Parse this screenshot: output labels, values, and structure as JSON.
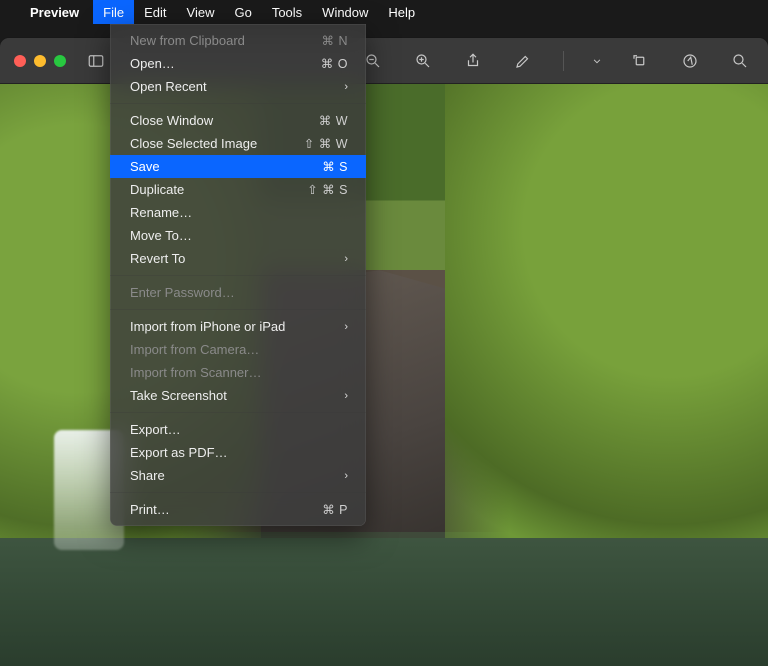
{
  "menubar": {
    "app_name": "Preview",
    "items": [
      "File",
      "Edit",
      "View",
      "Go",
      "Tools",
      "Window",
      "Help"
    ],
    "active_index": 0
  },
  "toolbar": {
    "icons": [
      "sidebar",
      "zoom-out",
      "zoom-in",
      "share",
      "markup",
      "dropdown",
      "rotate",
      "info",
      "search"
    ]
  },
  "dropdown": {
    "groups": [
      [
        {
          "label": "New from Clipboard",
          "shortcut": "⌘ N",
          "disabled": true
        },
        {
          "label": "Open…",
          "shortcut": "⌘ O"
        },
        {
          "label": "Open Recent",
          "submenu": true
        }
      ],
      [
        {
          "label": "Close Window",
          "shortcut": "⌘ W"
        },
        {
          "label": "Close Selected Image",
          "shortcut": "⇧ ⌘ W"
        },
        {
          "label": "Save",
          "shortcut": "⌘ S",
          "selected": true
        },
        {
          "label": "Duplicate",
          "shortcut": "⇧ ⌘ S"
        },
        {
          "label": "Rename…"
        },
        {
          "label": "Move To…"
        },
        {
          "label": "Revert To",
          "submenu": true
        }
      ],
      [
        {
          "label": "Enter Password…",
          "disabled": true
        }
      ],
      [
        {
          "label": "Import from iPhone or iPad",
          "submenu": true
        },
        {
          "label": "Import from Camera…",
          "disabled": true
        },
        {
          "label": "Import from Scanner…",
          "disabled": true
        },
        {
          "label": "Take Screenshot",
          "submenu": true
        }
      ],
      [
        {
          "label": "Export…"
        },
        {
          "label": "Export as PDF…"
        },
        {
          "label": "Share",
          "submenu": true
        }
      ],
      [
        {
          "label": "Print…",
          "shortcut": "⌘ P"
        }
      ]
    ]
  }
}
